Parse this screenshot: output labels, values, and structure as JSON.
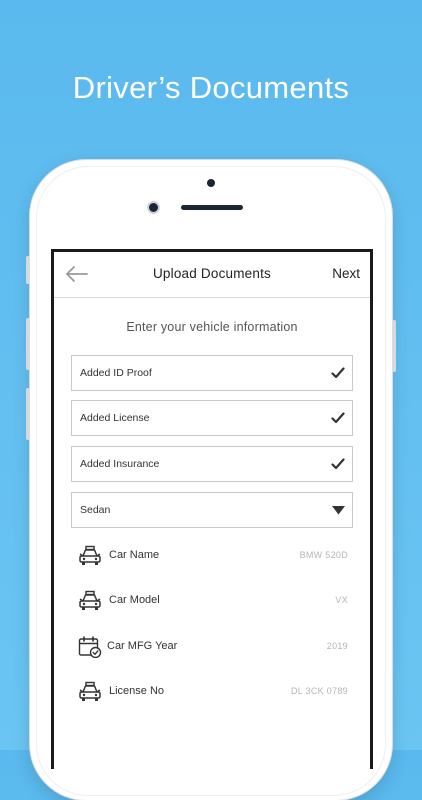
{
  "headline": "Driver’s Documents",
  "navbar": {
    "back_icon": "arrow-left-icon",
    "title": "Upload Documents",
    "next_label": "Next"
  },
  "subtitle": "Enter your vehicle information",
  "documents": [
    {
      "label": "Added ID Proof",
      "icon": "checkmark-icon"
    },
    {
      "label": "Added License",
      "icon": "checkmark-icon"
    },
    {
      "label": "Added Insurance",
      "icon": "checkmark-icon"
    }
  ],
  "vehicle_type": {
    "selected": "Sedan",
    "icon": "dropdown-caret-icon"
  },
  "vehicle_info": [
    {
      "label": "Car Name",
      "value": "BMW 520D",
      "icon": "car-icon"
    },
    {
      "label": "Car Model",
      "value": "VX",
      "icon": "car-icon"
    },
    {
      "label": "Car MFG Year",
      "value": "2019",
      "icon": "calendar-icon"
    },
    {
      "label": "License No",
      "value": "DL 3CK 0789",
      "icon": "car-icon"
    }
  ],
  "colors": {
    "background": "#5ab9ee",
    "screen_border": "#1a1a1a",
    "field_border": "#c9c9c9"
  }
}
